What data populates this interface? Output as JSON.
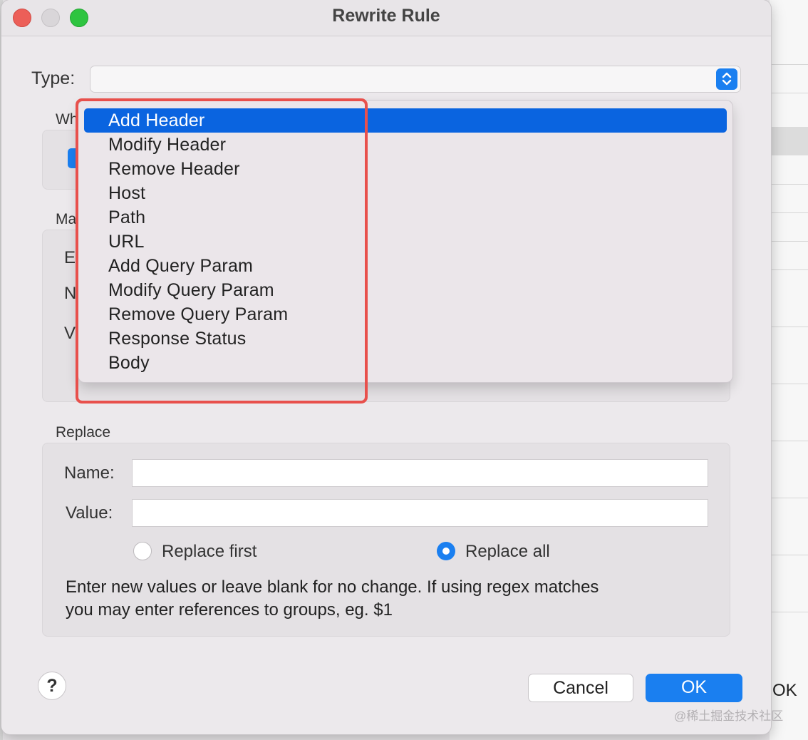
{
  "window": {
    "title": "Rewrite Rule"
  },
  "type_field": {
    "label": "Type:",
    "value": ""
  },
  "partial_labels": {
    "where_group": "Wh",
    "match_group": "Ma",
    "match_row_1": "E",
    "match_row_2": "N",
    "match_row_3": "V"
  },
  "type_menu": {
    "items": [
      "Add Header",
      "Modify Header",
      "Remove Header",
      "Host",
      "Path",
      "URL",
      "Add Query Param",
      "Modify Query Param",
      "Remove Query Param",
      "Response Status",
      "Body"
    ],
    "selected": "Add Header"
  },
  "replace": {
    "title": "Replace",
    "name_label": "Name:",
    "name_value": "",
    "value_label": "Value:",
    "value_value": "",
    "replace_first_label": "Replace first",
    "replace_all_label": "Replace all",
    "selected_option": "Replace all",
    "help_line_1": "Enter new values or leave blank for no change. If using regex matches",
    "help_line_2": "you may enter references to groups, eg. $1"
  },
  "buttons": {
    "help": "?",
    "cancel": "Cancel",
    "ok": "OK"
  },
  "background": {
    "ok_peek": "OK"
  },
  "watermark": "@稀土掘金技术社区",
  "colors": {
    "accent": "#1a7ff0",
    "menu_selection": "#0a64e0",
    "highlight_border": "#e8504c"
  }
}
